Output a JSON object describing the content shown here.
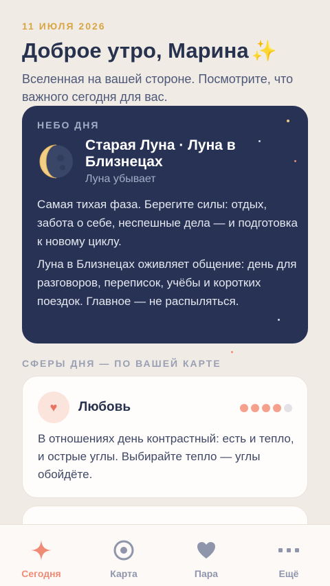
{
  "header": {
    "date": "11 ИЮЛЯ 2026",
    "greeting": "Доброе утро, Марина",
    "greeting_emoji": "✨",
    "subtitle": "Вселенная на вашей стороне. Посмотрите, что важного сегодня для вас."
  },
  "sky": {
    "label": "НЕБО ДНЯ",
    "icon": "moon-icon",
    "title": "Старая Луна · Луна в Близнецах",
    "subtitle": "Луна убывает",
    "text1": "Самая тихая фаза. Берегите силы: отдых, забота о себе, неспешные дела — и подготовка к новому циклу.",
    "text2": "Луна в Близнецах оживляет общение: день для разговоров, переписок, учёбы и коротких поездок. Главное — не распыляться."
  },
  "spheres": {
    "label": "СФЕРЫ ДНЯ — ПО ВАШЕЙ КАРТЕ",
    "items": [
      {
        "icon": "heart-icon",
        "title": "Любовь",
        "rating": 4,
        "rating_max": 5,
        "text": "В отношениях день контрастный: есть и тепло, и острые углы. Выбирайте тепло — углы обойдёте."
      }
    ]
  },
  "nav": {
    "items": [
      {
        "label": "Сегодня",
        "icon": "sparkle-icon",
        "active": true
      },
      {
        "label": "Карта",
        "icon": "chart-circle-icon",
        "active": false
      },
      {
        "label": "Пара",
        "icon": "heart-icon",
        "active": false
      },
      {
        "label": "Ещё",
        "icon": "more-icon",
        "active": false
      }
    ]
  },
  "colors": {
    "accent": "#f08b76",
    "gold": "#d9a646",
    "navy": "#273254",
    "background": "#f1ebe5"
  }
}
